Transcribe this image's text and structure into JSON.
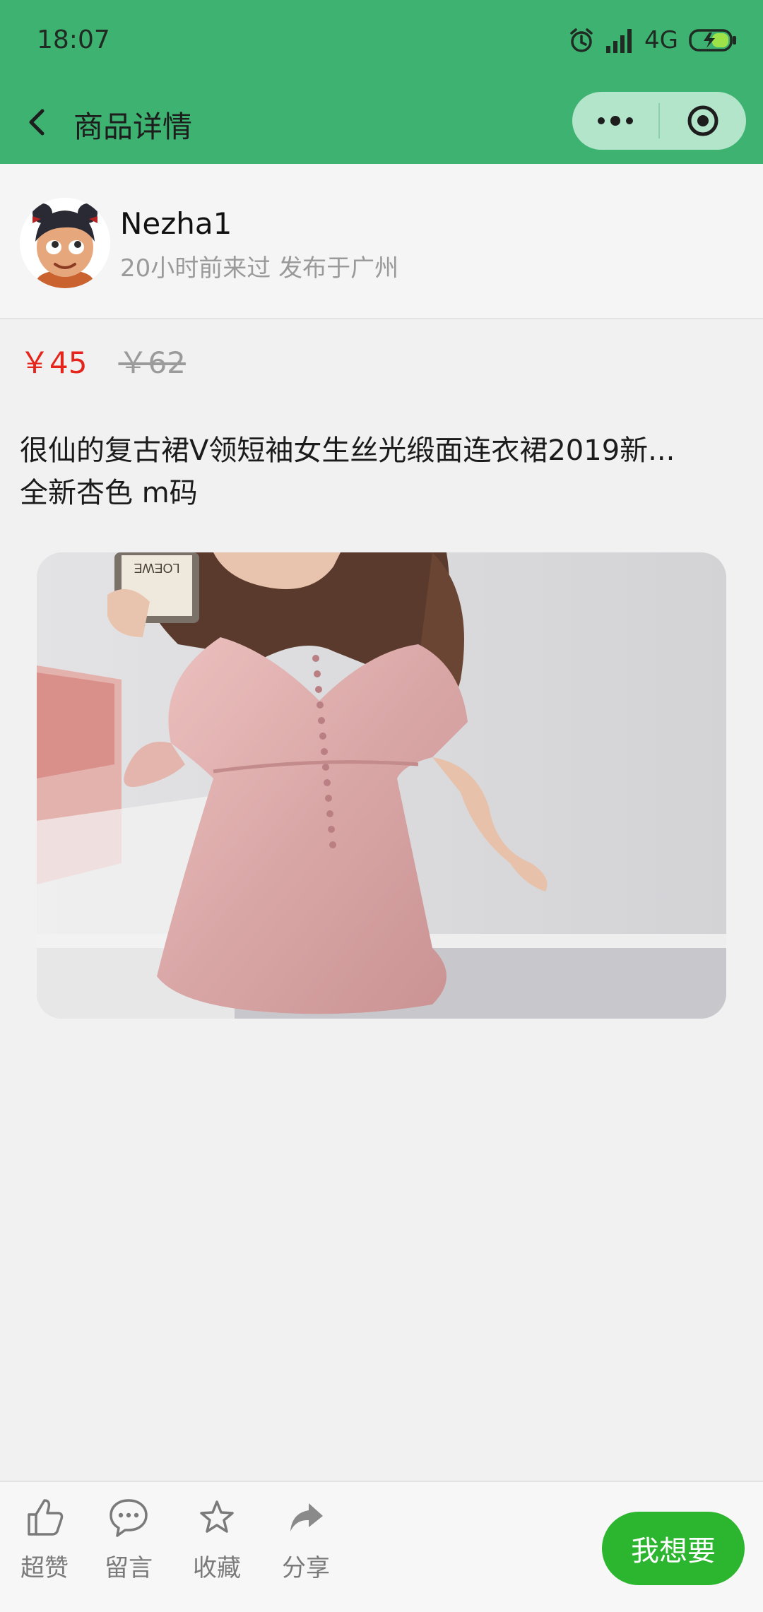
{
  "status_bar": {
    "time": "18:07",
    "network": "4G"
  },
  "nav": {
    "title": "商品详情"
  },
  "seller": {
    "name": "Nezha1",
    "meta": "20小时前来过 发布于广州"
  },
  "price": {
    "current": "￥45",
    "original": "￥62"
  },
  "description": {
    "line1": "很仙的复古裙V领短袖女生丝光缎面连衣裙2019新...",
    "line2": "全新杏色 m码"
  },
  "product_image": {
    "brand_text": "LOEWE"
  },
  "bottom_bar": {
    "like": "超赞",
    "comment": "留言",
    "favorite": "收藏",
    "share": "分享",
    "want": "我想要"
  },
  "colors": {
    "header_green": "#3eb371",
    "price_red": "#e5251b",
    "cta_green": "#2cb52f"
  }
}
